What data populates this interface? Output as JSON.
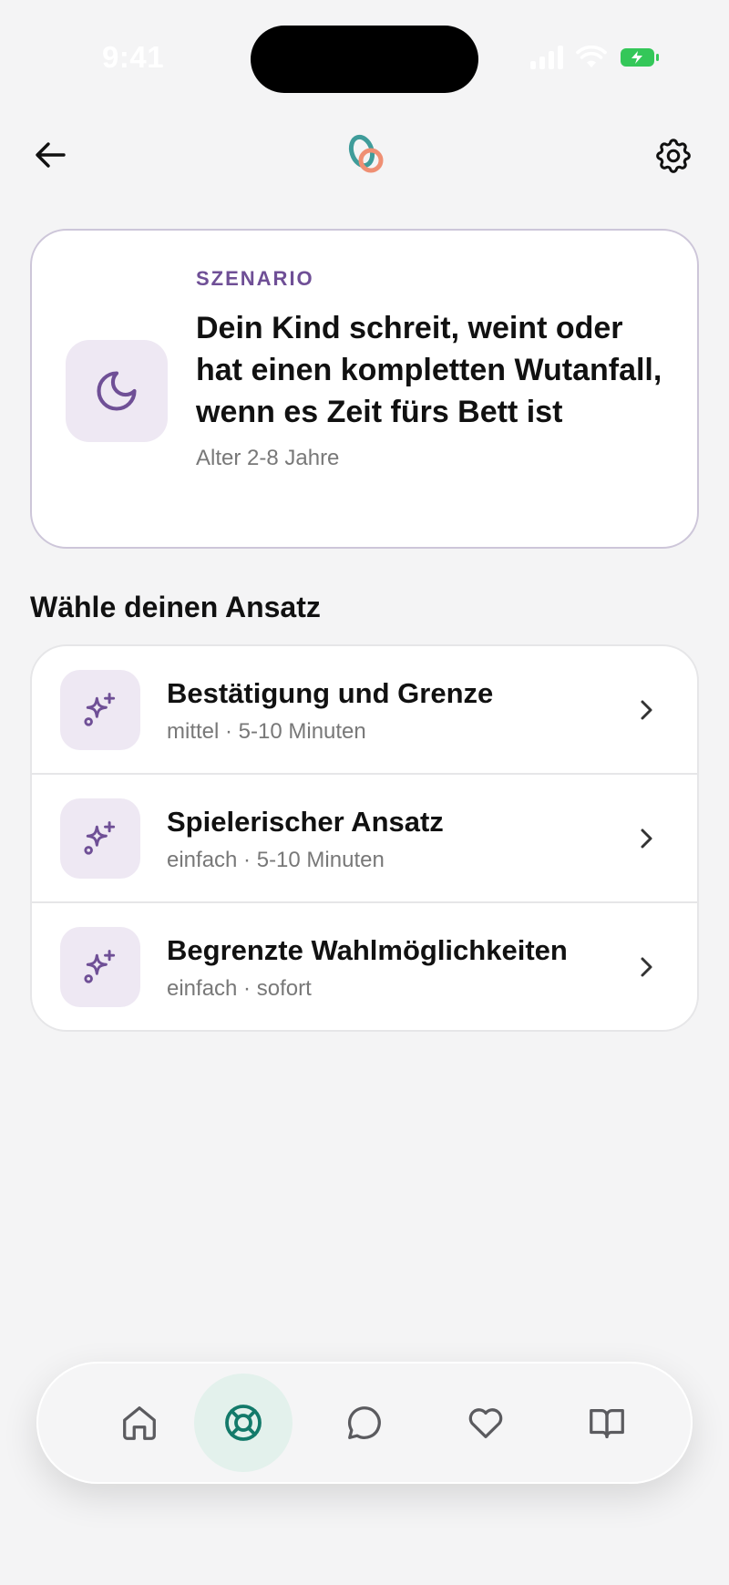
{
  "status_bar": {
    "time": "9:41"
  },
  "header": {
    "back_icon": "arrow-left-icon",
    "logo_icon": "app-logo-icon",
    "settings_icon": "gear-icon"
  },
  "scenario": {
    "kicker": "SZENARIO",
    "title": "Dein Kind schreit, weint oder hat einen kompletten Wutanfall, wenn es Zeit fürs Bett ist",
    "age": "Alter 2-8 Jahre",
    "icon": "moon-icon"
  },
  "section_title": "Wähle deinen Ansatz",
  "approaches": [
    {
      "title": "Bestätigung und Grenze",
      "meta": "mittel · 5-10 Minuten",
      "icon": "sparkles-icon"
    },
    {
      "title": "Spielerischer Ansatz",
      "meta": "einfach · 5-10 Minuten",
      "icon": "sparkles-icon"
    },
    {
      "title": "Begrenzte Wahlmöglichkeiten",
      "meta": "einfach · sofort",
      "icon": "sparkles-icon"
    }
  ],
  "nav": {
    "items": [
      {
        "icon": "home-icon",
        "active": false
      },
      {
        "icon": "lifebuoy-icon",
        "active": true
      },
      {
        "icon": "chat-bubble-icon",
        "active": false
      },
      {
        "icon": "heart-icon",
        "active": false
      },
      {
        "icon": "book-icon",
        "active": false
      }
    ]
  },
  "colors": {
    "accent_purple": "#6f4f96",
    "icon_bg": "#eee8f3",
    "active_teal": "#137a6a",
    "active_bg": "#e3f1ec",
    "battery_green": "#34c759"
  }
}
